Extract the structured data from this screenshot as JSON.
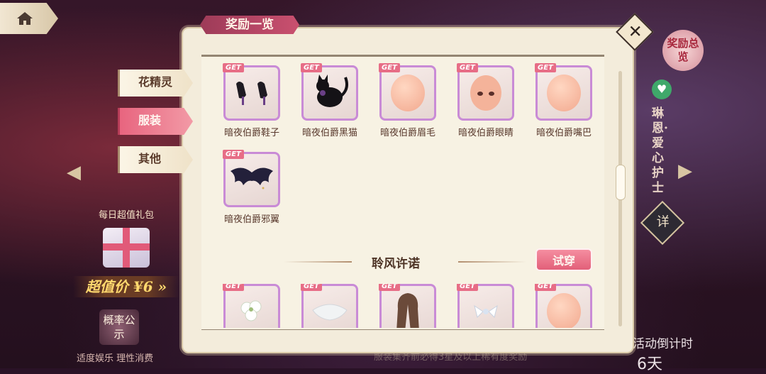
{
  "home": {
    "icon": "home-icon"
  },
  "panel": {
    "title": "奖励一览",
    "close_icon": "close-icon"
  },
  "tabs": [
    {
      "label": "花精灵",
      "active": false
    },
    {
      "label": "服装",
      "active": true
    },
    {
      "label": "其他",
      "active": false
    }
  ],
  "badge_text": "GET",
  "items_row1": [
    {
      "label": "暗夜伯爵鞋子",
      "icon": "shoes-icon"
    },
    {
      "label": "暗夜伯爵黑猫",
      "icon": "black-cat-icon"
    },
    {
      "label": "暗夜伯爵眉毛",
      "icon": "face-icon"
    },
    {
      "label": "暗夜伯爵眼睛",
      "icon": "face-eyes-icon"
    },
    {
      "label": "暗夜伯爵嘴巴",
      "icon": "face-icon"
    }
  ],
  "items_row2": [
    {
      "label": "暗夜伯爵邪翼",
      "icon": "bat-wings-icon"
    }
  ],
  "section": {
    "title": "聆风许诺",
    "try_on": "试穿"
  },
  "items_row3": [
    {
      "icon": "flower-bouquet-icon"
    },
    {
      "icon": "lace-veil-icon"
    },
    {
      "icon": "long-hair-icon"
    },
    {
      "icon": "hair-ornament-icon"
    },
    {
      "icon": "face-icon"
    }
  ],
  "left_side": {
    "daily_pack_title": "每日超值礼包",
    "price_text": "超值价 ¥6 »",
    "probability": "概率公示",
    "notice": "适度娱乐 理性消费"
  },
  "right_side": {
    "reward_overview": "奖励总览",
    "character_name": "琳恩·爱心护士",
    "detail": "详",
    "countdown_label": "活动倒计时",
    "countdown_value": "6天"
  },
  "bottom_notice": "服装集齐前必得3星及以上稀有度奖励",
  "colors": {
    "accent": "#e8657f",
    "card_border": "#c98bd6",
    "panel_bg": "#f3ecdb"
  }
}
